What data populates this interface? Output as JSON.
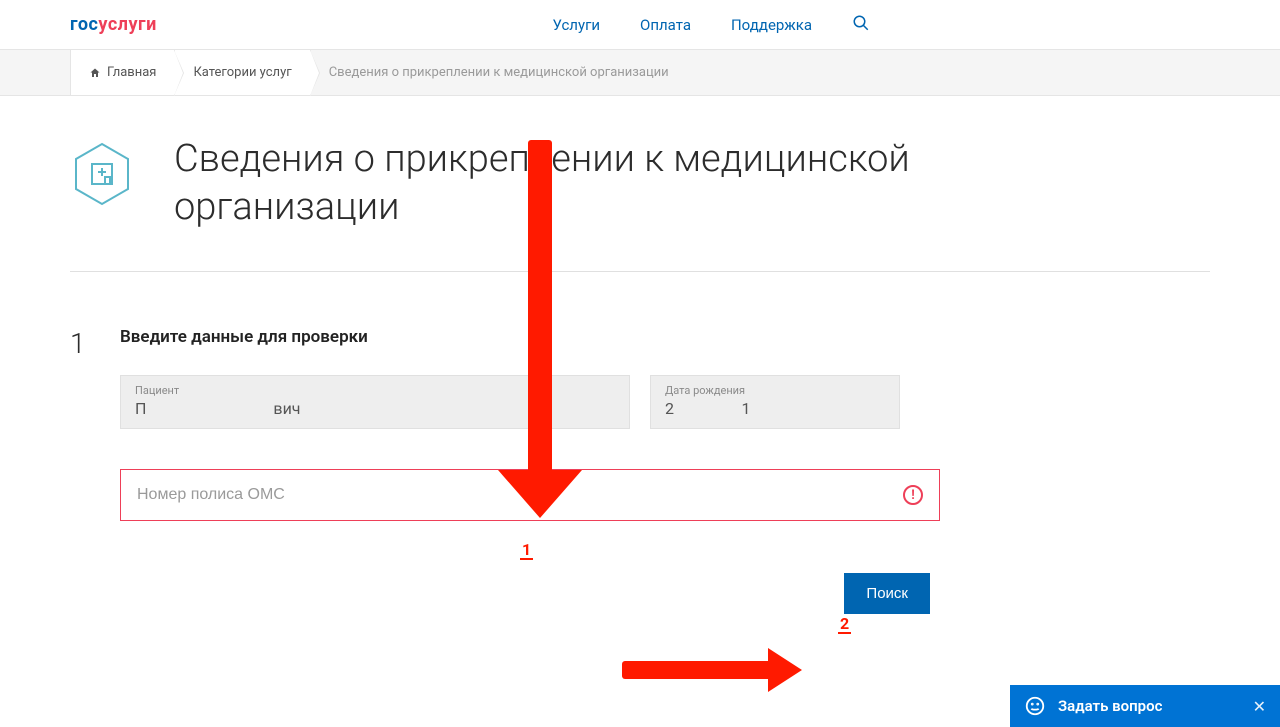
{
  "header": {
    "logo_part1": "гос",
    "logo_part2": "услуги",
    "nav": {
      "services": "Услуги",
      "payment": "Оплата",
      "support": "Поддержка"
    }
  },
  "breadcrumb": {
    "home": "Главная",
    "categories": "Категории услуг",
    "current": "Сведения о прикреплении к медицинской организации"
  },
  "page": {
    "title": "Сведения о прикреплении к медицинской организации"
  },
  "step1": {
    "number": "1",
    "title": "Введите данные для проверки",
    "patient_label": "Пациент",
    "patient_value": "П                                вич",
    "dob_label": "Дата рождения",
    "dob_value": "2                 1",
    "policy_placeholder": "Номер полиса ОМС",
    "error_glyph": "!",
    "submit_label": "Поиск"
  },
  "annotation": {
    "label1": "1",
    "label2": "2"
  },
  "chat": {
    "label": "Задать вопрос",
    "close_glyph": "✕"
  }
}
